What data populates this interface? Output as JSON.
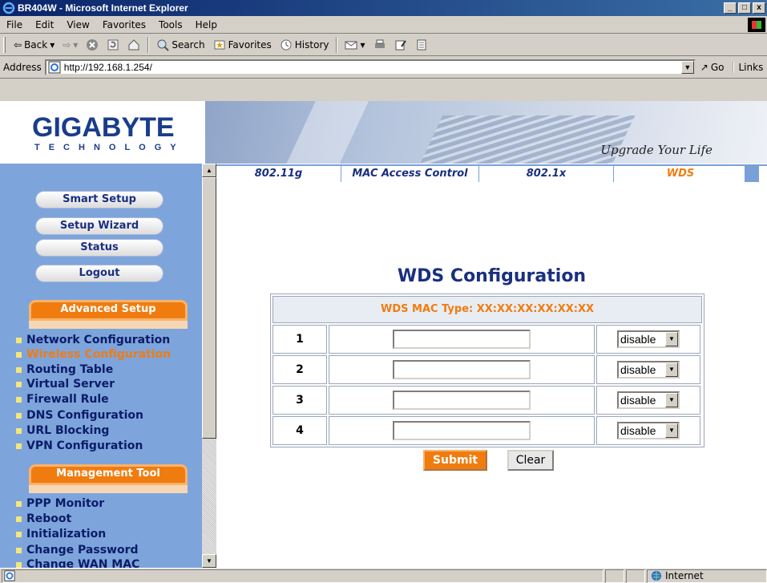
{
  "window": {
    "title": "BR404W - Microsoft Internet Explorer",
    "buttons": [
      "_",
      "□",
      "x"
    ]
  },
  "menu": [
    "File",
    "Edit",
    "View",
    "Favorites",
    "Tools",
    "Help"
  ],
  "toolbar": {
    "back": "Back",
    "search": "Search",
    "favorites": "Favorites",
    "history": "History"
  },
  "address": {
    "label": "Address",
    "url": "http://192.168.1.254/",
    "go": "Go",
    "links": "Links"
  },
  "brand": {
    "logo": "GIGABYTE",
    "logo_sub": "TECHNOLOGY",
    "tagline": "Upgrade Your Life"
  },
  "tabs": [
    {
      "label": "802.11g"
    },
    {
      "label": "MAC Access Control"
    },
    {
      "label": "802.1x"
    },
    {
      "label": "WDS",
      "active": true
    }
  ],
  "sidebar": {
    "buttons": [
      "Smart Setup",
      "Setup Wizard",
      "Status",
      "Logout"
    ],
    "advanced_setup": {
      "title": "Advanced Setup",
      "items": [
        "Network Configuration",
        "Wireless Configuration",
        "Routing Table",
        "Virtual Server",
        "Firewall Rule",
        "DNS Configuration",
        "URL Blocking",
        "VPN Configuration"
      ],
      "active_index": 1
    },
    "management_tool": {
      "title": "Management Tool",
      "items": [
        "PPP Monitor",
        "Reboot",
        "Initialization",
        "Change Password",
        "Change WAN MAC"
      ]
    }
  },
  "main": {
    "title": "WDS Configuration",
    "table_header": "WDS MAC Type: XX:XX:XX:XX:XX:XX",
    "rows": [
      {
        "num": "1",
        "mac": "",
        "mode": "disable"
      },
      {
        "num": "2",
        "mac": "",
        "mode": "disable"
      },
      {
        "num": "3",
        "mac": "",
        "mode": "disable"
      },
      {
        "num": "4",
        "mac": "",
        "mode": "disable"
      }
    ],
    "submit_label": "Submit",
    "clear_label": "Clear"
  },
  "status": {
    "zone": "Internet"
  },
  "colors": {
    "accent_orange": "#f07c10",
    "nav_blue": "#1a2f80",
    "sidebar_bg": "#7ea4dc"
  }
}
